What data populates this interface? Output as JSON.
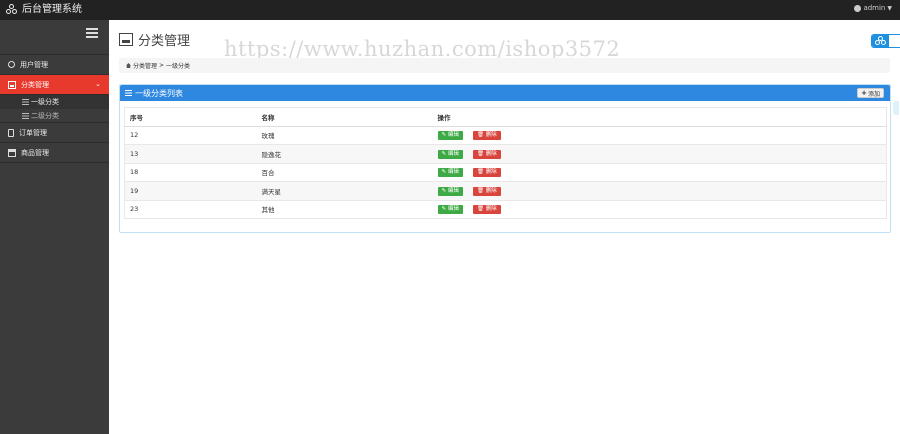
{
  "topbar": {
    "brand": "后台管理系统",
    "user": "admin"
  },
  "sidebar": {
    "items": [
      {
        "label": "用户管理"
      },
      {
        "label": "分类管理"
      },
      {
        "label": "订单管理"
      },
      {
        "label": "商品管理"
      }
    ],
    "subitems": [
      {
        "label": "一级分类"
      },
      {
        "label": "二级分类"
      }
    ]
  },
  "header": {
    "title": "分类管理",
    "watermark": "https://www.huzhan.com/ishop3572"
  },
  "breadcrumb": {
    "root": "分类管理",
    "separator": ">",
    "current": "一级分类"
  },
  "panel": {
    "title": "一级分类列表",
    "add_label": "添加"
  },
  "table": {
    "headers": [
      "序号",
      "名称",
      "操作"
    ],
    "edit_label": "编辑",
    "delete_label": "删除",
    "rows": [
      {
        "id": "12",
        "name": "玫瑰"
      },
      {
        "id": "13",
        "name": "隐逸花"
      },
      {
        "id": "18",
        "name": "百合"
      },
      {
        "id": "19",
        "name": "满天星"
      },
      {
        "id": "23",
        "name": "其他"
      }
    ]
  },
  "colors": {
    "sidebar_active": "#e8392d",
    "panel_head": "#2e88e0",
    "edit_button": "#3daa45",
    "delete_button": "#d9453d"
  }
}
